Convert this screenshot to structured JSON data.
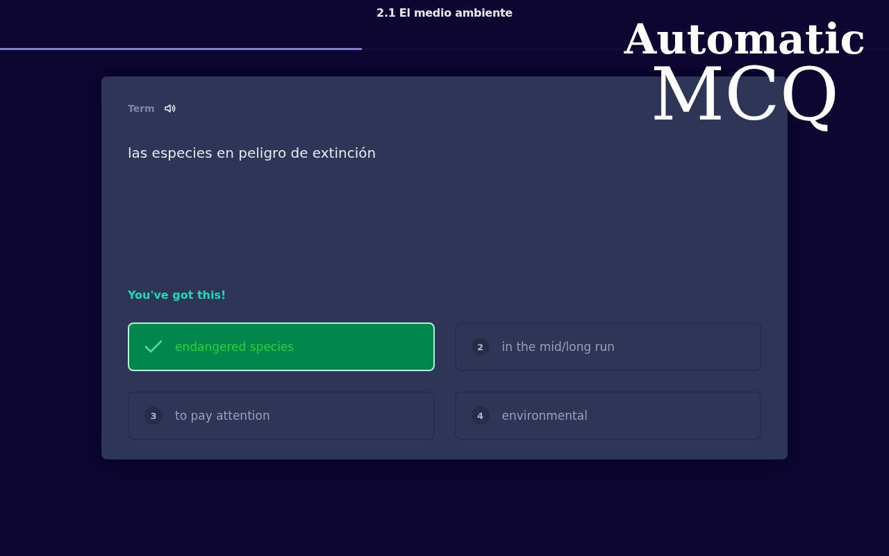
{
  "header": {
    "title": "2.1 El medio ambiente",
    "progress": {
      "level": 0.407
    }
  },
  "card": {
    "label": "Term",
    "term": "las especies en peligro de extinción",
    "prompt": "You've got this!",
    "options": [
      {
        "label": "endangered species",
        "selected": true
      },
      {
        "number": "2",
        "label": "in the mid/long run",
        "selected": false
      },
      {
        "number": "3",
        "label": "to pay attention",
        "selected": false
      },
      {
        "number": "4",
        "label": "environmental",
        "selected": false
      }
    ]
  },
  "overlay": {
    "line_1": "Automatic",
    "line_2": "MCQ"
  }
}
